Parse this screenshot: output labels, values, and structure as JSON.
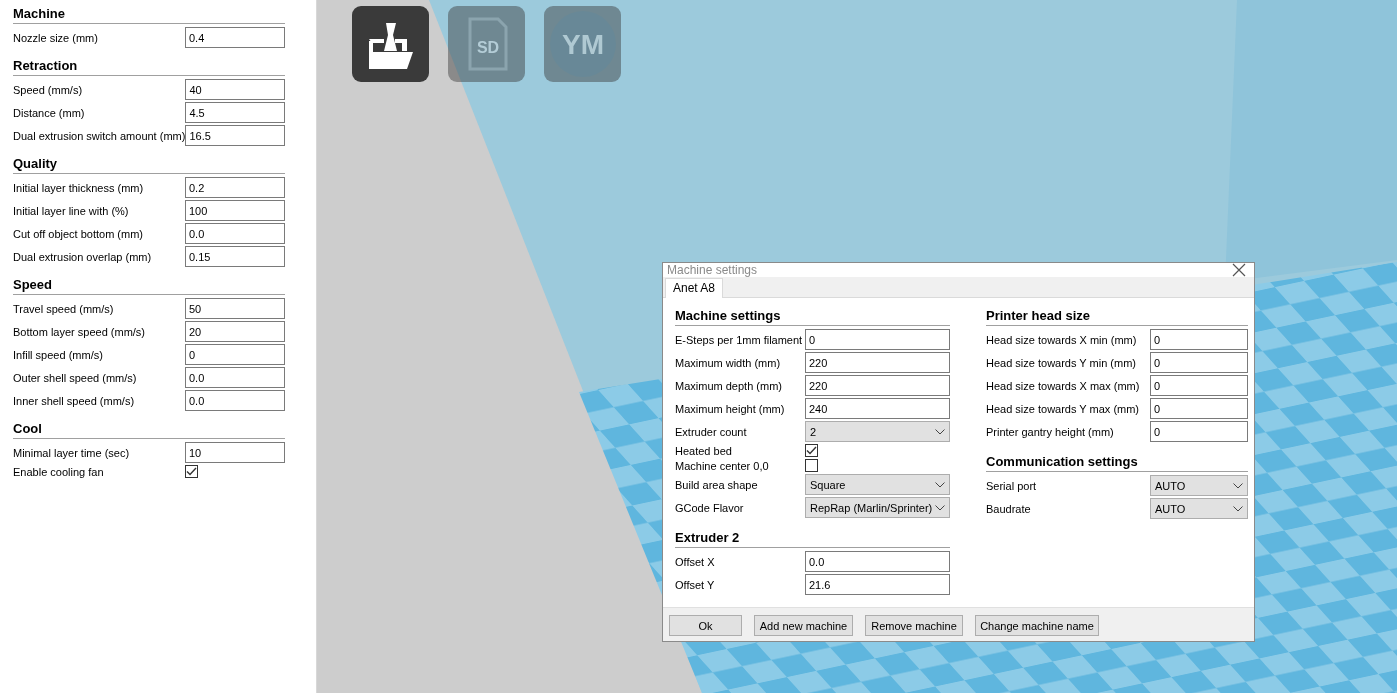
{
  "sidebar": {
    "sections": [
      {
        "title": "Machine",
        "rows": [
          {
            "kind": "field",
            "label": "Nozzle size (mm)",
            "value": "0.4"
          }
        ]
      },
      {
        "title": "Retraction",
        "rows": [
          {
            "kind": "field",
            "label": "Speed (mm/s)",
            "value": "40"
          },
          {
            "kind": "field",
            "label": "Distance (mm)",
            "value": "4.5"
          },
          {
            "kind": "field",
            "label": "Dual extrusion switch amount (mm)",
            "value": "16.5"
          }
        ]
      },
      {
        "title": "Quality",
        "rows": [
          {
            "kind": "field",
            "label": "Initial layer thickness (mm)",
            "value": "0.2"
          },
          {
            "kind": "field",
            "label": "Initial layer line with (%)",
            "value": "100"
          },
          {
            "kind": "field",
            "label": "Cut off object bottom (mm)",
            "value": "0.0"
          },
          {
            "kind": "field",
            "label": "Dual extrusion overlap (mm)",
            "value": "0.15"
          }
        ]
      },
      {
        "title": "Speed",
        "rows": [
          {
            "kind": "field",
            "label": "Travel speed (mm/s)",
            "value": "50"
          },
          {
            "kind": "field",
            "label": "Bottom layer speed (mm/s)",
            "value": "20"
          },
          {
            "kind": "field",
            "label": "Infill speed (mm/s)",
            "value": "0"
          },
          {
            "kind": "field",
            "label": "Outer shell speed (mm/s)",
            "value": "0.0"
          },
          {
            "kind": "field",
            "label": "Inner shell speed (mm/s)",
            "value": "0.0"
          }
        ]
      },
      {
        "title": "Cool",
        "rows": [
          {
            "kind": "field",
            "label": "Minimal layer time (sec)",
            "value": "10"
          },
          {
            "kind": "checkbox",
            "label": "Enable cooling fan",
            "checked": true
          }
        ]
      }
    ]
  },
  "toolbar": [
    {
      "kind": "load",
      "disabled": false
    },
    {
      "kind": "sd",
      "label": "SD",
      "disabled": true
    },
    {
      "kind": "ym",
      "label": "YM",
      "disabled": true
    }
  ],
  "dialog": {
    "title": "Machine settings",
    "tabs": [
      {
        "label": "Anet A8",
        "selected": true
      }
    ],
    "columns": [
      {
        "sections": [
          {
            "title": "Machine settings",
            "rows": [
              {
                "kind": "field",
                "label": "E-Steps per 1mm filament",
                "value": "0"
              },
              {
                "kind": "field",
                "label": "Maximum width (mm)",
                "value": "220"
              },
              {
                "kind": "field",
                "label": "Maximum depth (mm)",
                "value": "220"
              },
              {
                "kind": "field",
                "label": "Maximum height (mm)",
                "value": "240"
              },
              {
                "kind": "select",
                "label": "Extruder count",
                "value": "2"
              },
              {
                "kind": "checkbox",
                "label": "Heated bed",
                "checked": true
              },
              {
                "kind": "checkbox",
                "label": "Machine center 0,0",
                "checked": false
              },
              {
                "kind": "select",
                "label": "Build area shape",
                "value": "Square"
              },
              {
                "kind": "select",
                "label": "GCode Flavor",
                "value": "RepRap (Marlin/Sprinter)"
              }
            ]
          },
          {
            "title": "Extruder 2",
            "rows": [
              {
                "kind": "field",
                "label": "Offset X",
                "value": "0.0"
              },
              {
                "kind": "field",
                "label": "Offset Y",
                "value": "21.6"
              }
            ]
          }
        ]
      },
      {
        "sections": [
          {
            "title": "Printer head size",
            "rows": [
              {
                "kind": "field",
                "label": "Head size towards X min (mm)",
                "value": "0"
              },
              {
                "kind": "field",
                "label": "Head size towards Y min (mm)",
                "value": "0"
              },
              {
                "kind": "field",
                "label": "Head size towards X max (mm)",
                "value": "0"
              },
              {
                "kind": "field",
                "label": "Head size towards Y max (mm)",
                "value": "0"
              },
              {
                "kind": "field",
                "label": "Printer gantry height (mm)",
                "value": "0"
              }
            ]
          },
          {
            "title": "Communication settings",
            "rows": [
              {
                "kind": "select",
                "label": "Serial port",
                "value": "AUTO"
              },
              {
                "kind": "select",
                "label": "Baudrate",
                "value": "AUTO"
              }
            ]
          }
        ]
      }
    ],
    "buttons": [
      "Ok",
      "Add new machine",
      "Remove machine",
      "Change machine name"
    ]
  }
}
